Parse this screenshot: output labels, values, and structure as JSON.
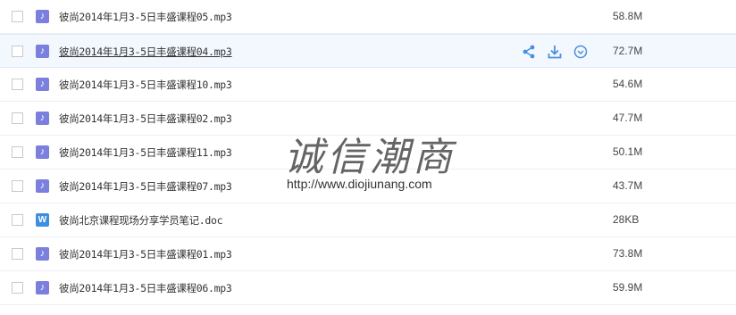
{
  "files": [
    {
      "type": "mp3",
      "icon": "music-file-icon",
      "glyph": "♪",
      "name": "彼尚2014年1月3-5日丰盛课程05.mp3",
      "size": "58.8M",
      "hover": false
    },
    {
      "type": "mp3",
      "icon": "music-file-icon",
      "glyph": "♪",
      "name": "彼尚2014年1月3-5日丰盛课程04.mp3",
      "size": "72.7M",
      "hover": true
    },
    {
      "type": "mp3",
      "icon": "music-file-icon",
      "glyph": "♪",
      "name": "彼尚2014年1月3-5日丰盛课程10.mp3",
      "size": "54.6M",
      "hover": false
    },
    {
      "type": "mp3",
      "icon": "music-file-icon",
      "glyph": "♪",
      "name": "彼尚2014年1月3-5日丰盛课程02.mp3",
      "size": "47.7M",
      "hover": false
    },
    {
      "type": "mp3",
      "icon": "music-file-icon",
      "glyph": "♪",
      "name": "彼尚2014年1月3-5日丰盛课程11.mp3",
      "size": "50.1M",
      "hover": false
    },
    {
      "type": "mp3",
      "icon": "music-file-icon",
      "glyph": "♪",
      "name": "彼尚2014年1月3-5日丰盛课程07.mp3",
      "size": "43.7M",
      "hover": false
    },
    {
      "type": "doc",
      "icon": "word-doc-icon",
      "glyph": "W",
      "name": "彼尚北京课程现场分享学员笔记.doc",
      "size": "28KB",
      "hover": false
    },
    {
      "type": "mp3",
      "icon": "music-file-icon",
      "glyph": "♪",
      "name": "彼尚2014年1月3-5日丰盛课程01.mp3",
      "size": "73.8M",
      "hover": false
    },
    {
      "type": "mp3",
      "icon": "music-file-icon",
      "glyph": "♪",
      "name": "彼尚2014年1月3-5日丰盛课程06.mp3",
      "size": "59.9M",
      "hover": false
    }
  ],
  "row_actions": {
    "share_icon": "share-icon",
    "download_icon": "download-icon",
    "more_icon": "more-icon"
  },
  "colors": {
    "action_blue": "#4a90d9",
    "mp3_icon": "#7b7fde",
    "doc_icon": "#3f8fe0",
    "hover_row": "#f3f8ff"
  },
  "watermark": {
    "title": "诚信潮商",
    "url": "http://www.diojiunang.com"
  }
}
